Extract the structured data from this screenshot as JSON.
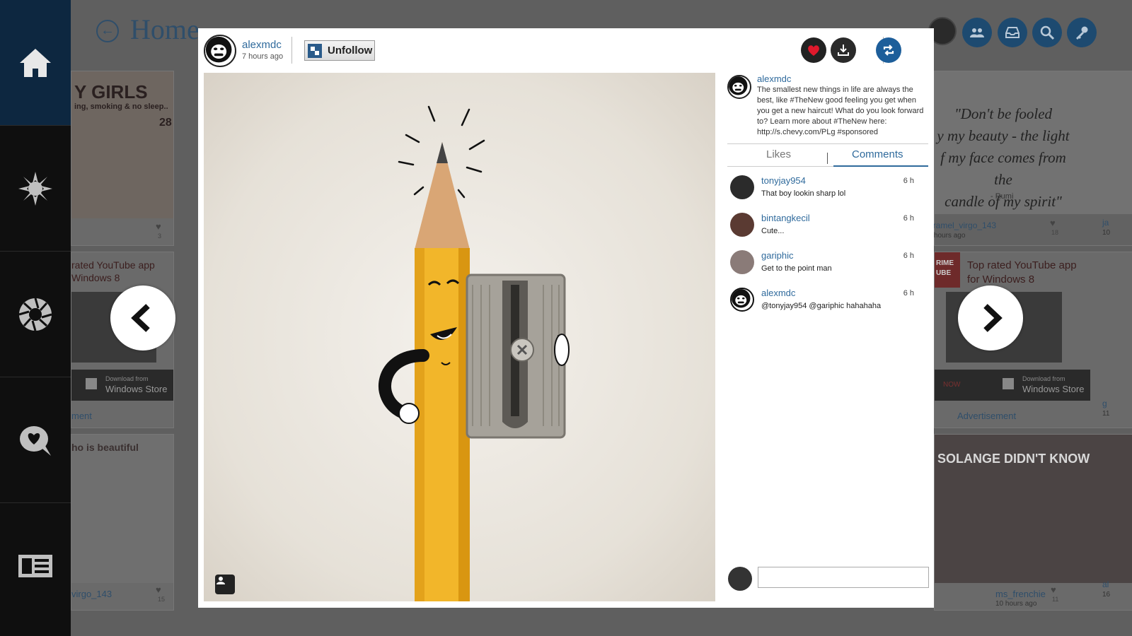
{
  "colors": {
    "accent": "#2f6a9c",
    "sidebar_active": "#0d2740",
    "like_red": "#e0192c",
    "header_button": "#1d4a70"
  },
  "sidebar": {
    "items": [
      {
        "icon": "home-icon"
      },
      {
        "icon": "star-icon"
      },
      {
        "icon": "camera-aperture-icon"
      },
      {
        "icon": "heart-chat-icon"
      },
      {
        "icon": "news-icon"
      }
    ]
  },
  "background": {
    "title": "Home",
    "header_buttons": [
      "people-icon",
      "inbox-icon",
      "search-icon",
      "key-icon"
    ],
    "tiles": {
      "girls_banner": "Y GIRLS",
      "girls_sub": "ing, smoking & no sleep..",
      "girls_num": "28",
      "girls_likes": "3",
      "ad_left_title_1": "rated YouTube app",
      "ad_left_title_2": "Windows 8",
      "store_left_small": "Download from",
      "store_left_big": "Windows Store",
      "ad_left_label": "ment",
      "beautiful_caption": "ho is beautiful",
      "left_bottom_user": "virgo_143",
      "left_bottom_likes": "15",
      "quote": "\"Don't be fooled by my beauty - the light of my face comes from the candle of my spirit\"",
      "quote_visible_1": "\"Don't be fooled",
      "quote_visible_2": "y my beauty - the light",
      "quote_visible_3": "f my face comes from the",
      "quote_visible_4": "candle of my spirit\"",
      "quote_by": "- Rumi",
      "right_user_1": "caramel_virgo_143",
      "right_time_1": "10 hours ago",
      "right_likes_1": "18",
      "ad_right_title_1": "Top rated YouTube app",
      "ad_right_title_2": "for Windows 8",
      "ad_right_brand_1": "RIME",
      "ad_right_brand_2": "UBE",
      "ad_right_now": "NOW",
      "store_right_small": "Download from",
      "store_right_big": "Windows Store",
      "ad_right_label": "Advertisement",
      "solange_caption": "SOLANGE DIDN'T KNOW",
      "right_user_2": "ms_frenchie",
      "right_time_2": "10 hours ago",
      "right_likes_2": "11",
      "edge_user_1": "ja",
      "edge_num_1": "10",
      "edge_user_2": "g",
      "edge_num_2": "11",
      "edge_user_3": "al",
      "edge_num_3": "16"
    }
  },
  "nav": {
    "prev_icon": "chevron-left-icon",
    "next_icon": "chevron-right-icon"
  },
  "post": {
    "username": "alexmdc",
    "time": "7 hours ago",
    "unfollow_label": "Unfollow",
    "caption": "The smallest new things in life are always the best, like #TheNew good feeling you get when you get a new haircut! What do you look forward to?  Learn more about #TheNew here: http://s.chevy.com/PLg #sponsored",
    "liked": true,
    "actions": [
      "like-icon",
      "download-icon",
      "repost-icon"
    ]
  },
  "tabs": {
    "likes": "Likes",
    "comments": "Comments",
    "active": "Comments"
  },
  "comments": [
    {
      "user": "tonyjay954",
      "time": "6 h",
      "text": "That boy lookin sharp lol"
    },
    {
      "user": "bintangkecil",
      "time": "6 h",
      "text": "Cute..."
    },
    {
      "user": "gariphic",
      "time": "6 h",
      "text": "Get to the point man"
    },
    {
      "user": "alexmdc",
      "time": "6 h",
      "text": "@tonyjay954 @gariphic hahahaha"
    }
  ],
  "comment_input": {
    "value": "",
    "placeholder": ""
  }
}
